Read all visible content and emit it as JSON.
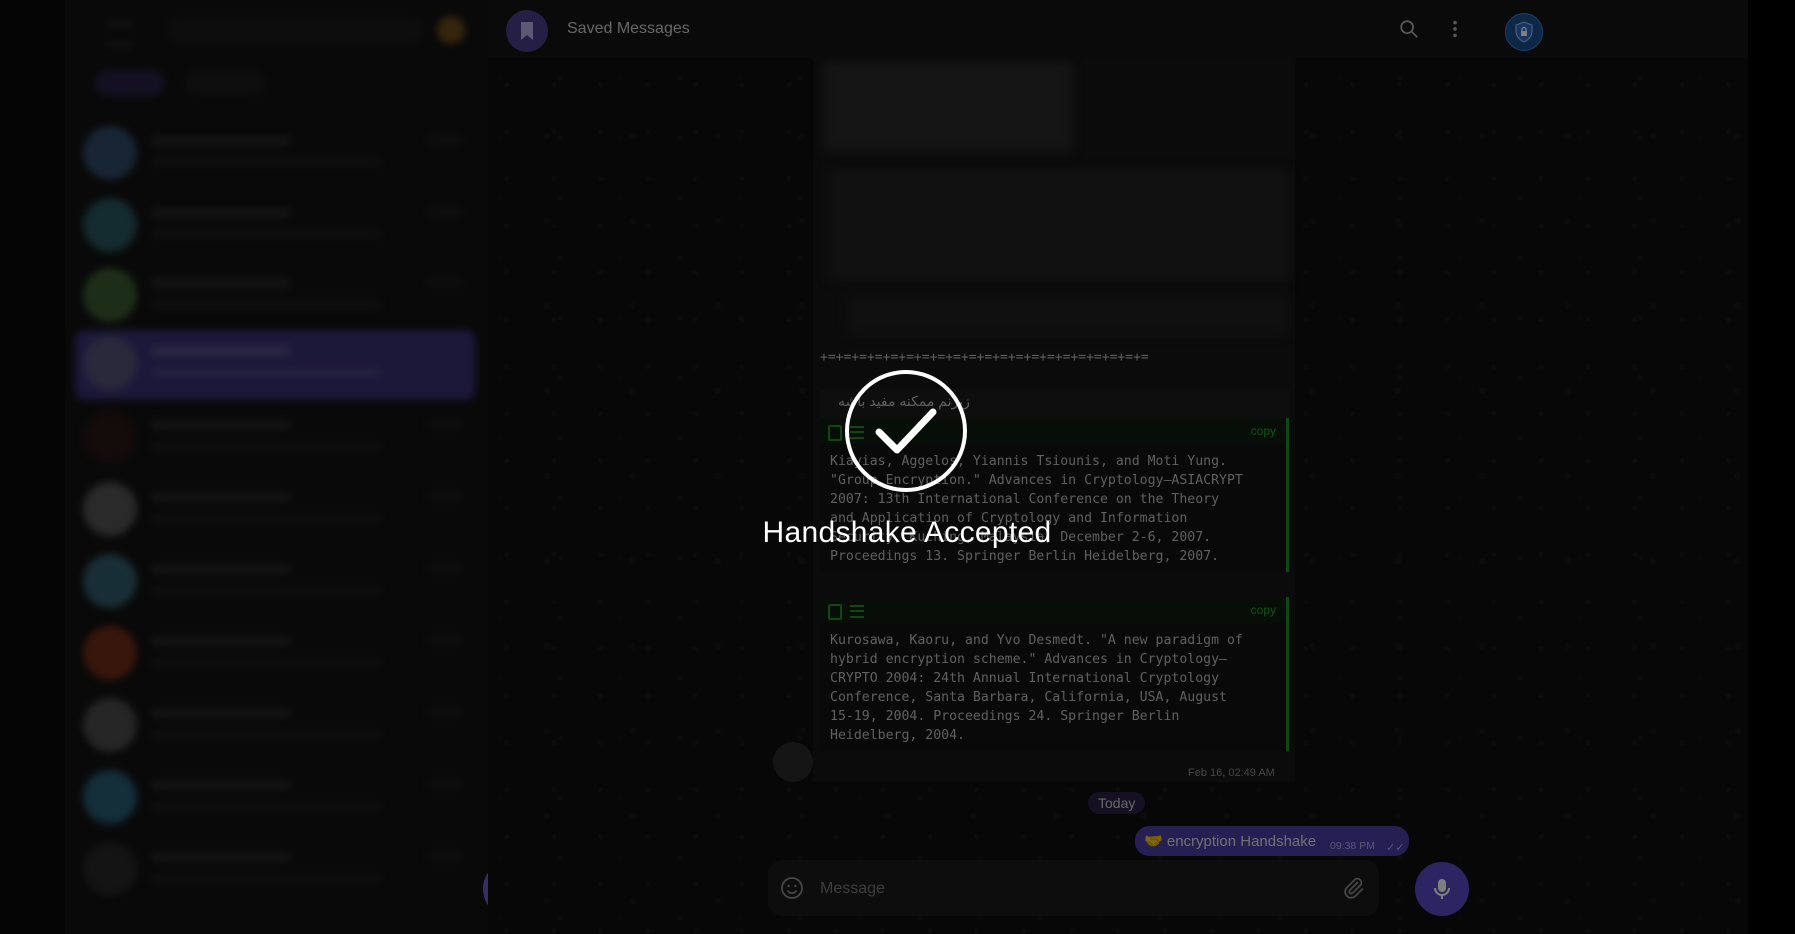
{
  "header": {
    "title": "Saved Messages",
    "icons": {
      "avatar": "bookmark-icon",
      "search": "search-icon",
      "more": "more-vertical-icon",
      "lock": "shield-lock-icon"
    }
  },
  "messages": {
    "divider": "+=+=+=+=+=+=+=+=+=+=+=+=+=+=+=+=+=+=+=+=+=",
    "rtl_text": "زیرنم ممکنه مفید باشه",
    "code_blocks": [
      {
        "copy_label": "copy",
        "text": "Kiayias, Aggelos, Yiannis Tsiounis, and Moti Yung.\n\"Group Encryption.\" Advances in Cryptology—ASIACRYPT\n2007: 13th International Conference on the Theory\nand Application of Cryptology and Information\nSecurity, Kuching, Malaysia, December 2-6, 2007.\nProceedings 13. Springer Berlin Heidelberg, 2007."
      },
      {
        "copy_label": "copy",
        "text": "Kurosawa, Kaoru, and Yvo Desmedt. \"A new paradigm of\nhybrid encryption scheme.\" Advances in Cryptology—\nCRYPTO 2004: 24th Annual International Cryptology\nConference, Santa Barbara, California, USA, August\n15-19, 2004. Proceedings 24. Springer Berlin\nHeidelberg, 2004."
      }
    ],
    "timestamp": "Feb 16, 02:49 AM",
    "date_separator": "Today",
    "handshake": {
      "emoji": "🤝",
      "text": "encryption Handshake",
      "time": "09:38 PM",
      "status": "✓✓"
    }
  },
  "composer": {
    "placeholder": "Message"
  },
  "overlay": {
    "title": "Handshake Accepted"
  },
  "colors": {
    "accent": "#5a49c7",
    "code_border": "#1f8f2a",
    "lock_blue": "#1b4f8f"
  }
}
